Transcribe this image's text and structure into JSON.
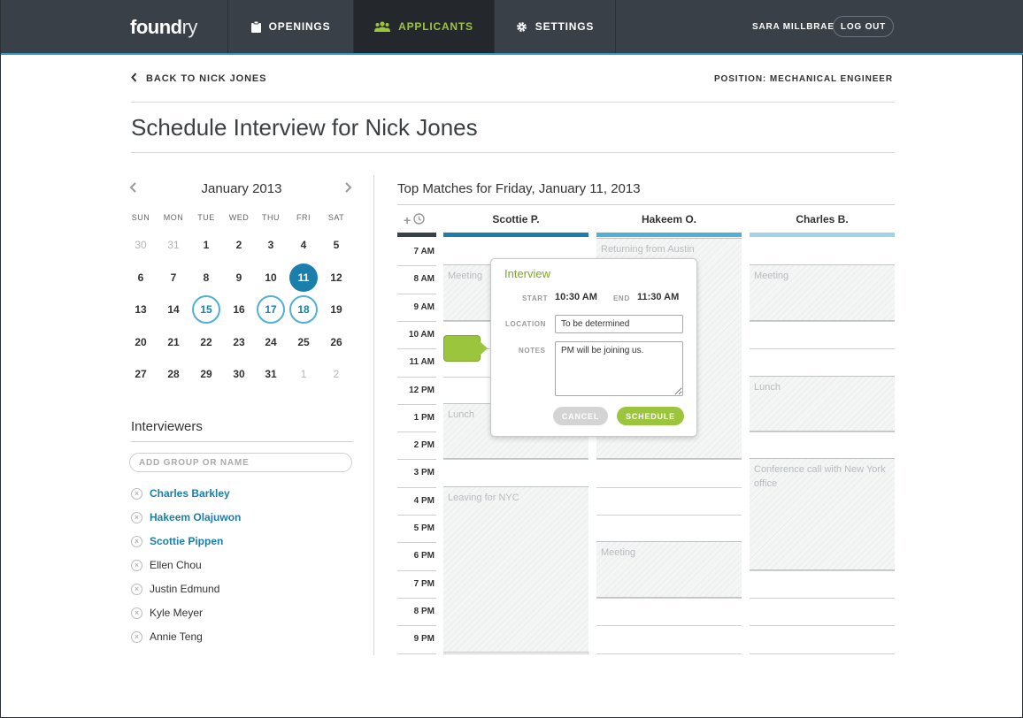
{
  "nav": {
    "logo_bold": "found",
    "logo_light": "ry",
    "tabs": [
      {
        "label": "OPENINGS",
        "icon": "clipboard-icon"
      },
      {
        "label": "APPLICANTS",
        "icon": "people-icon",
        "active": true
      },
      {
        "label": "SETTINGS",
        "icon": "gear-icon"
      }
    ],
    "user": "SARA MILLBRAE",
    "logout": "LOG OUT"
  },
  "header": {
    "back": "BACK TO NICK JONES",
    "position": "POSITION: MECHANICAL ENGINEER",
    "title": "Schedule Interview for Nick Jones"
  },
  "calendar": {
    "month": "January 2013",
    "weekdays": [
      "SUN",
      "MON",
      "TUE",
      "WED",
      "THU",
      "FRI",
      "SAT"
    ],
    "weeks": [
      [
        "30",
        "31",
        "1",
        "2",
        "3",
        "4",
        "5"
      ],
      [
        "6",
        "7",
        "8",
        "9",
        "10",
        "11",
        "12"
      ],
      [
        "13",
        "14",
        "15",
        "16",
        "17",
        "18",
        "19"
      ],
      [
        "20",
        "21",
        "22",
        "23",
        "24",
        "25",
        "26"
      ],
      [
        "27",
        "28",
        "29",
        "30",
        "31",
        "1",
        "2"
      ]
    ],
    "selected_day": "11",
    "highlighted_days": [
      "15",
      "17",
      "18"
    ]
  },
  "interviewers": {
    "title": "Interviewers",
    "placeholder": "ADD GROUP OR NAME",
    "people": [
      {
        "name": "Charles Barkley",
        "selected": true
      },
      {
        "name": "Hakeem Olajuwon",
        "selected": true
      },
      {
        "name": "Scottie Pippen",
        "selected": true
      },
      {
        "name": "Ellen Chou",
        "selected": false
      },
      {
        "name": "Justin Edmund",
        "selected": false
      },
      {
        "name": "Kyle Meyer",
        "selected": false
      },
      {
        "name": "Annie Teng",
        "selected": false
      }
    ]
  },
  "schedule": {
    "title": "Top Matches for Friday, January 11, 2013",
    "times": [
      "7 AM",
      "8 AM",
      "9 AM",
      "10 AM",
      "11 AM",
      "12 PM",
      "1 PM",
      "2 PM",
      "3 PM",
      "4 PM",
      "5 PM",
      "6 PM",
      "7 PM",
      "8 PM",
      "9 PM"
    ],
    "columns": [
      {
        "name": "Scottie P.",
        "bar_color": "#1a7fab",
        "events": [
          {
            "label": "Meeting",
            "start": "8 AM",
            "end": "10 AM"
          },
          {
            "label": "Lunch",
            "start": "1 PM",
            "end": "3 PM"
          },
          {
            "label": "Leaving for NYC",
            "start": "4 PM",
            "end": "10 PM"
          }
        ]
      },
      {
        "name": "Hakeem O.",
        "bar_color": "#4fb0d8",
        "events": [
          {
            "label": "Returning from Austin",
            "start": "7 AM",
            "end": "3 PM"
          },
          {
            "label": "Meeting",
            "start": "6 PM",
            "end": "8 PM"
          }
        ]
      },
      {
        "name": "Charles B.",
        "bar_color": "#9fd3e6",
        "events": [
          {
            "label": "Meeting",
            "start": "8 AM",
            "end": "10 AM"
          },
          {
            "label": "Lunch",
            "start": "12 PM",
            "end": "2 PM"
          },
          {
            "label": "Conference call with New York office",
            "start": "3 PM",
            "end": "7 PM"
          }
        ]
      }
    ]
  },
  "popover": {
    "title": "Interview",
    "start_label": "START",
    "start": "10:30 AM",
    "end_label": "END",
    "end": "11:30 AM",
    "location_label": "LOCATION",
    "location": "To be determined",
    "notes_label": "NOTES",
    "notes": "PM will be joining us.",
    "cancel": "CANCEL",
    "schedule": "SCHEDULE"
  },
  "colors": {
    "nav_bg": "#3a4047",
    "accent_blue": "#1a7fab",
    "accent_green": "#9bc53d"
  }
}
